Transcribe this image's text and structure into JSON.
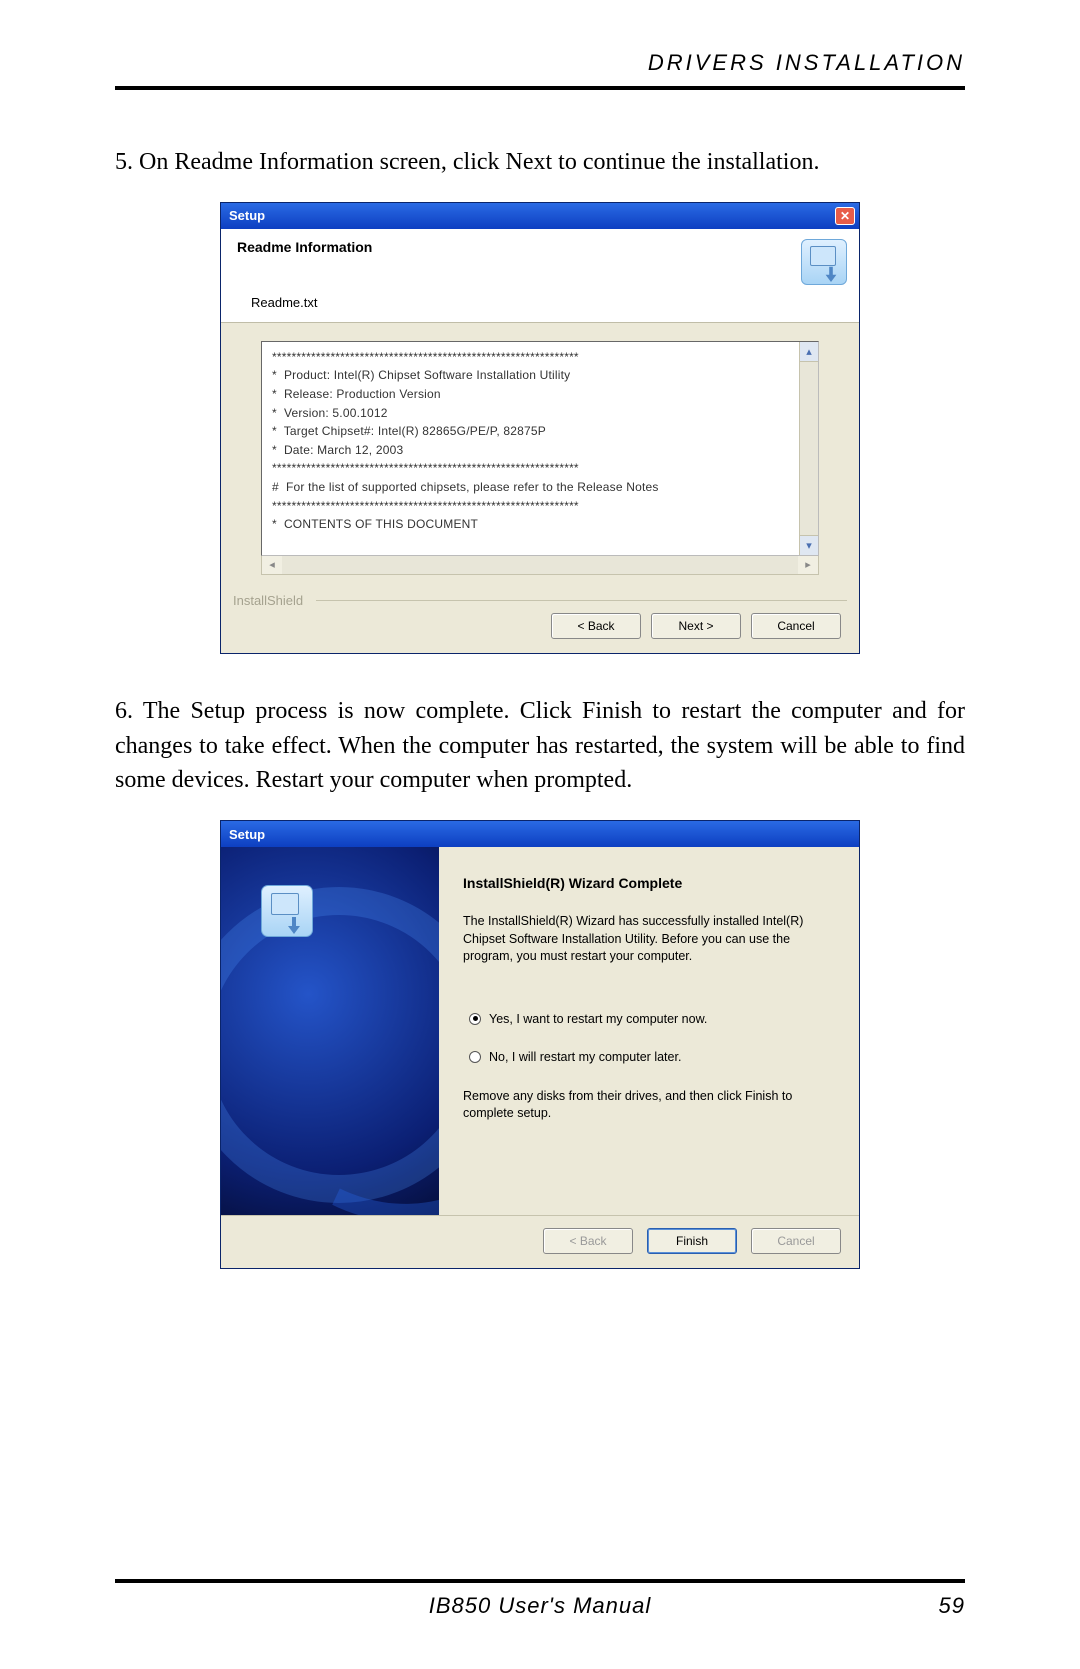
{
  "header": {
    "title": "DRIVERS INSTALLATION"
  },
  "step5": {
    "text": "5. On Readme Information screen, click Next to continue the installation."
  },
  "dialog1": {
    "title": "Setup",
    "heading": "Readme Information",
    "subheading": "Readme.txt",
    "readme": {
      "l0": "***************************************************************",
      "l1": "*  Product: Intel(R) Chipset Software Installation Utility",
      "l2": "*  Release: Production Version",
      "l3": "*  Version: 5.00.1012",
      "l4": "*  Target Chipset#: Intel(R) 82865G/PE/P, 82875P",
      "l5": "*  Date: March 12, 2003",
      "l6": "***************************************************************",
      "l7": "",
      "l8": "#  For the list of supported chipsets, please refer to the Release Notes",
      "l9": "",
      "l10": "***************************************************************",
      "l11": "*  CONTENTS OF THIS DOCUMENT"
    },
    "brand": "InstallShield",
    "buttons": {
      "back": "< Back",
      "next": "Next >",
      "cancel": "Cancel"
    }
  },
  "step6": {
    "text": "6. The Setup process is now complete.  Click Finish to restart the computer and for changes to take effect. When the computer has restarted, the system will be able to find some devices. Restart your computer when prompted."
  },
  "dialog2": {
    "title": "Setup",
    "heading": "InstallShield(R) Wizard Complete",
    "para": "The InstallShield(R) Wizard has successfully installed Intel(R) Chipset Software Installation Utility.  Before you can use the program, you must restart your computer.",
    "opt_yes": "Yes, I want to restart my computer now.",
    "opt_no": "No, I will restart my computer later.",
    "note": "Remove any disks from their drives, and then click Finish to complete setup.",
    "buttons": {
      "back": "< Back",
      "finish": "Finish",
      "cancel": "Cancel"
    }
  },
  "footer": {
    "manual": "IB850 User's Manual",
    "page": "59"
  }
}
